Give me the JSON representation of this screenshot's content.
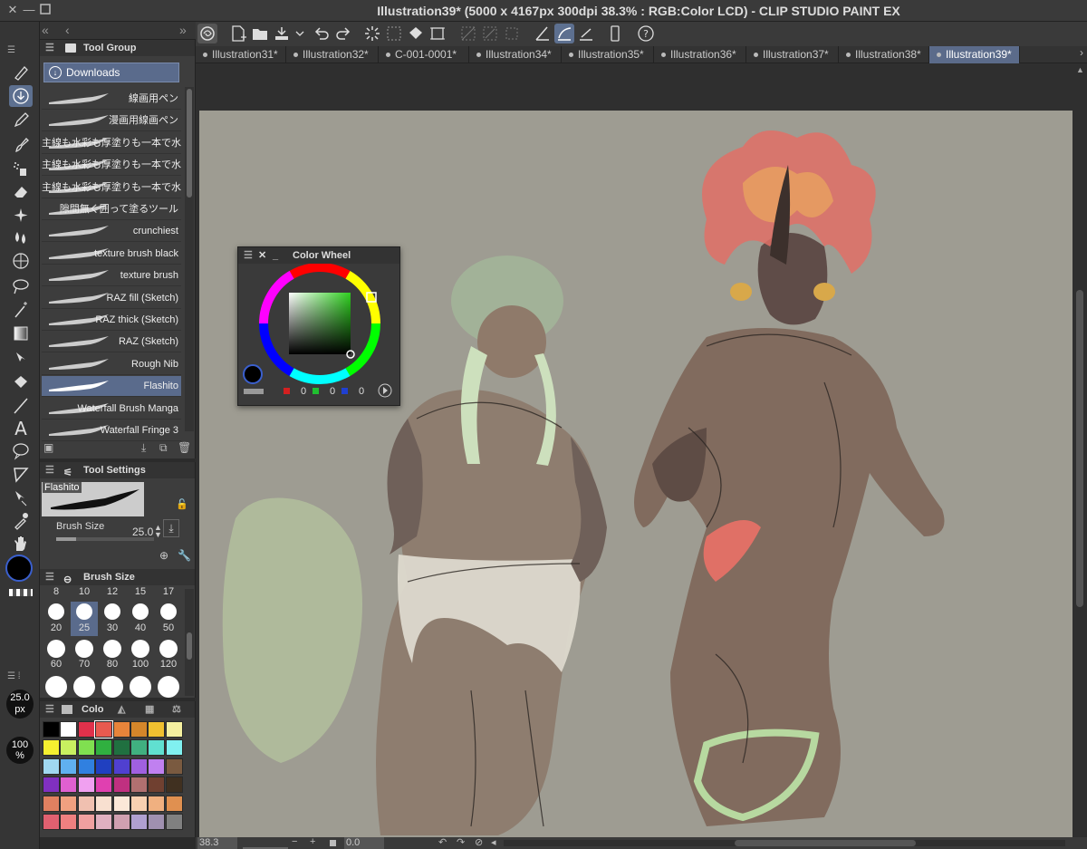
{
  "window": {
    "title": "Illustration39* (5000 x 4167px 300dpi 38.3% : RGB:Color LCD)  - CLIP STUDIO PAINT EX"
  },
  "tabs": [
    "Illustration31*",
    "Illustration32*",
    "C-001-0001*",
    "Illustration34*",
    "Illustration35*",
    "Illustration36*",
    "Illustration37*",
    "Illustration38*",
    "Illustration39*"
  ],
  "active_tab": "Illustration39*",
  "tool_group": {
    "title": "Tool Group",
    "selected": "Downloads",
    "brushes": [
      "線画用ペン",
      "漫画用線画ペン",
      "主線も水彩も厚塗りも一本で水",
      "主線も水彩も厚塗りも一本で水",
      "主線も水彩も厚塗りも一本で水",
      "隙間無く囲って塗るツール",
      "crunchiest",
      "texture brush black",
      "texture brush",
      "RAZ fill (Sketch)",
      "RAZ thick (Sketch)",
      "RAZ (Sketch)",
      "Rough Nib",
      "Flashito",
      "Waterfall Brush Manga",
      "Waterfall Fringe 3"
    ],
    "active_brush": "Flashito"
  },
  "tool_settings": {
    "title": "Tool Settings",
    "brush_name": "Flashito",
    "brush_size_label": "Brush Size",
    "brush_size_value": "25.0"
  },
  "brush_size_panel": {
    "title": "Brush Size",
    "top_row": [
      "8",
      "10",
      "12",
      "15",
      "17"
    ],
    "rows": [
      [
        "20",
        "25",
        "30",
        "40",
        "50"
      ],
      [
        "60",
        "70",
        "80",
        "100",
        "120"
      ]
    ],
    "selected": "25"
  },
  "indicators": {
    "size": "25.0",
    "size_unit": "px",
    "opacity": "100",
    "opacity_unit": "%"
  },
  "color_set": {
    "title": "Colo",
    "swatches": [
      "#000000",
      "#ffffff",
      "#e0314b",
      "#e85a4f",
      "#e8843a",
      "#d4862a",
      "#f0c030",
      "#f5f0a0",
      "#f5f030",
      "#c8f060",
      "#80e050",
      "#30b040",
      "#207040",
      "#40b080",
      "#60e0d0",
      "#80f0f0",
      "#a0d8f0",
      "#60b0f0",
      "#3080e0",
      "#2040c0",
      "#5040d0",
      "#a060e0",
      "#c080f0",
      "#7a5a40",
      "#8030c0",
      "#e060d0",
      "#f0a0f0",
      "#e040b0",
      "#c03080",
      "#b07070",
      "#704030",
      "#403020",
      "#e08060",
      "#f0a080",
      "#f0c0b0",
      "#f8e0d0",
      "#fbe8d8",
      "#f8d0b0",
      "#f0b080",
      "#e09050",
      "#e06070",
      "#f08080",
      "#f0a0a0",
      "#e0b0c0",
      "#d0a0b0",
      "#b0a0d0",
      "#a090b0",
      "#808080"
    ]
  },
  "color_wheel": {
    "title": "Color Wheel",
    "r": "0",
    "g": "0",
    "b": "0"
  },
  "status": {
    "zoom": "38.3",
    "angle": "0.0"
  }
}
